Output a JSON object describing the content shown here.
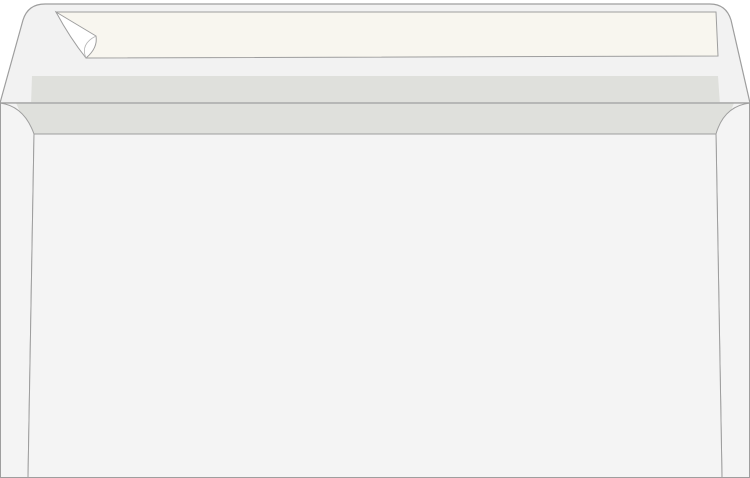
{
  "envelope": {
    "type": "open-flap-envelope-illustration",
    "colors": {
      "paper": "#f4f4f4",
      "flap": "#f2f2f2",
      "adhesive_strip": "#dfe0dc",
      "release_liner": "#f8f6ef",
      "outline": "#9e9e9e",
      "background": "#ffffff"
    },
    "peel_corner_icon": "peel-corner-icon"
  }
}
